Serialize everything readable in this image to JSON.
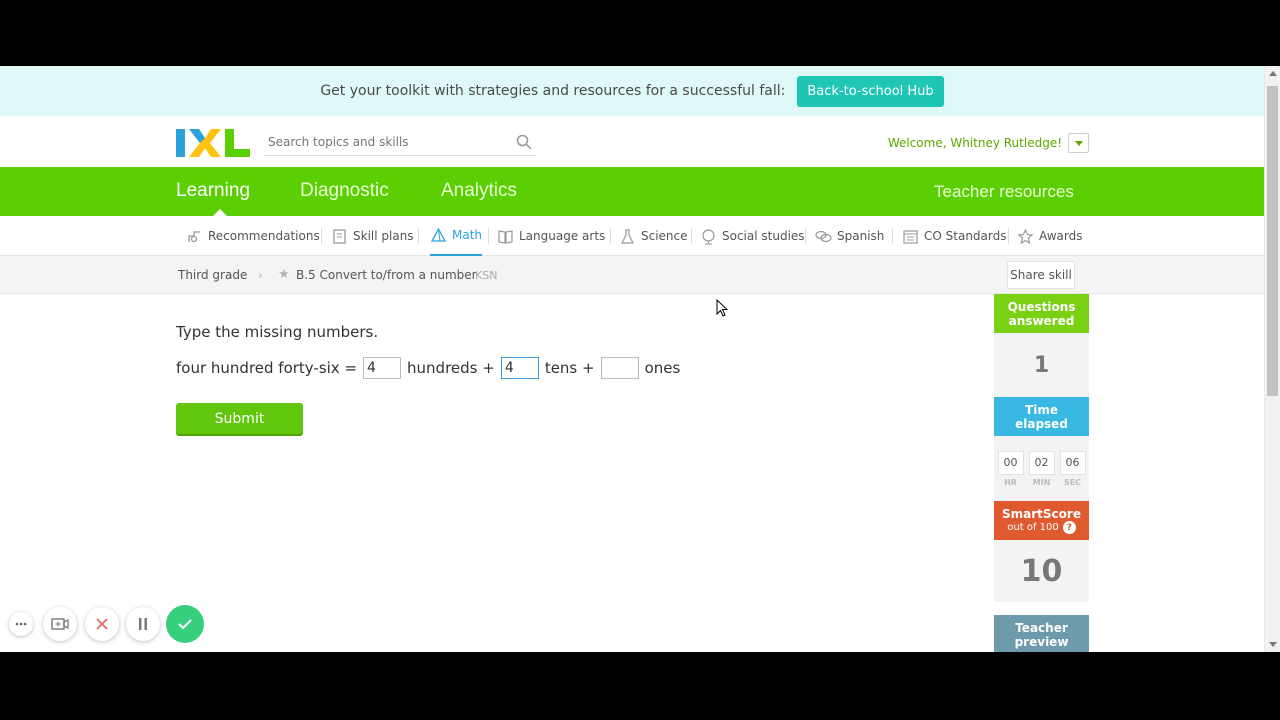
{
  "promo": {
    "message": "Get your toolkit with strategies and resources for a successful fall:",
    "button": "Back-to-school Hub"
  },
  "header": {
    "logo": "IXL",
    "search_placeholder": "Search topics and skills",
    "welcome": "Welcome, Whitney Rutledge!"
  },
  "main_nav": {
    "learning": "Learning",
    "diagnostic": "Diagnostic",
    "analytics": "Analytics",
    "teacher_resources": "Teacher resources"
  },
  "subject_nav": {
    "recommendations": "Recommendations",
    "skill_plans": "Skill plans",
    "math": "Math",
    "language_arts": "Language arts",
    "science": "Science",
    "social_studies": "Social studies",
    "spanish": "Spanish",
    "co_standards": "CO Standards",
    "awards": "Awards"
  },
  "breadcrumb": {
    "grade": "Third grade",
    "skill": "B.5 Convert to/from a number",
    "code": "KSN",
    "share": "Share skill"
  },
  "question": {
    "prompt": "Type the missing numbers.",
    "lhs": "four hundred forty-six =",
    "hundreds_value": "4",
    "hundreds_label": "hundreds +",
    "tens_value": "4",
    "tens_label": "tens +",
    "ones_value": "",
    "ones_label": "ones",
    "submit": "Submit"
  },
  "stats": {
    "questions_answered_label_1": "Questions",
    "questions_answered_label_2": "answered",
    "questions_answered": "1",
    "time_elapsed_label_1": "Time",
    "time_elapsed_label_2": "elapsed",
    "hr": "00",
    "min": "02",
    "sec": "06",
    "hr_unit": "HR",
    "min_unit": "MIN",
    "sec_unit": "SEC",
    "smartscore_label": "SmartScore",
    "smartscore_sub": "out of 100",
    "smartscore_help": "?",
    "smartscore": "10",
    "teacher_preview_1": "Teacher",
    "teacher_preview_2": "preview"
  },
  "colors": {
    "nav_green": "#5bcf04",
    "math_blue": "#2aa3d8",
    "questions_green": "#7ad114",
    "time_blue": "#3ab8e4",
    "smartscore_orange": "#e05a30",
    "teacher_slate": "#6e9bab",
    "promo_teal": "#1fc5b5"
  }
}
